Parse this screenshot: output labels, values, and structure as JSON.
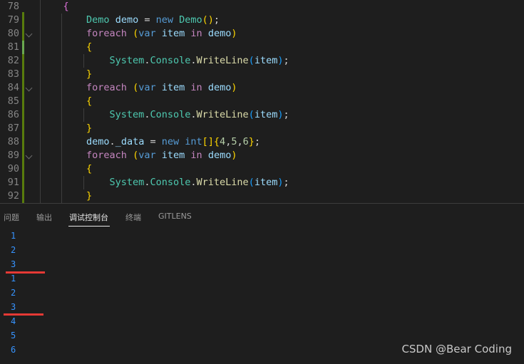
{
  "editor": {
    "lines": [
      {
        "num": "78",
        "fold": false,
        "tokens": [
          {
            "t": "    "
          },
          {
            "t": "{",
            "c": "b1"
          }
        ]
      },
      {
        "num": "79",
        "fold": false,
        "tokens": [
          {
            "t": "        "
          },
          {
            "t": "Demo",
            "c": "type"
          },
          {
            "t": " "
          },
          {
            "t": "demo",
            "c": "var"
          },
          {
            "t": " = ",
            "c": "p"
          },
          {
            "t": "new",
            "c": "kw"
          },
          {
            "t": " "
          },
          {
            "t": "Demo",
            "c": "type"
          },
          {
            "t": "()",
            "c": "b2"
          },
          {
            "t": ";",
            "c": "p"
          }
        ]
      },
      {
        "num": "80",
        "fold": true,
        "tokens": [
          {
            "t": "        "
          },
          {
            "t": "foreach",
            "c": "ctrl"
          },
          {
            "t": " "
          },
          {
            "t": "(",
            "c": "b2"
          },
          {
            "t": "var",
            "c": "kw"
          },
          {
            "t": " "
          },
          {
            "t": "item",
            "c": "var"
          },
          {
            "t": " "
          },
          {
            "t": "in",
            "c": "ctrl"
          },
          {
            "t": " "
          },
          {
            "t": "demo",
            "c": "var"
          },
          {
            "t": ")",
            "c": "b2"
          }
        ]
      },
      {
        "num": "81",
        "fold": false,
        "tokens": [
          {
            "t": "        "
          },
          {
            "t": "{",
            "c": "b2"
          }
        ]
      },
      {
        "num": "82",
        "fold": false,
        "tokens": [
          {
            "t": "            "
          },
          {
            "t": "System",
            "c": "type"
          },
          {
            "t": ".",
            "c": "p"
          },
          {
            "t": "Console",
            "c": "type"
          },
          {
            "t": ".",
            "c": "p"
          },
          {
            "t": "WriteLine",
            "c": "fn"
          },
          {
            "t": "(",
            "c": "b3"
          },
          {
            "t": "item",
            "c": "var"
          },
          {
            "t": ")",
            "c": "b3"
          },
          {
            "t": ";",
            "c": "p"
          }
        ]
      },
      {
        "num": "83",
        "fold": false,
        "tokens": [
          {
            "t": "        "
          },
          {
            "t": "}",
            "c": "b2"
          }
        ]
      },
      {
        "num": "84",
        "fold": true,
        "tokens": [
          {
            "t": "        "
          },
          {
            "t": "foreach",
            "c": "ctrl"
          },
          {
            "t": " "
          },
          {
            "t": "(",
            "c": "b2"
          },
          {
            "t": "var",
            "c": "kw"
          },
          {
            "t": " "
          },
          {
            "t": "item",
            "c": "var"
          },
          {
            "t": " "
          },
          {
            "t": "in",
            "c": "ctrl"
          },
          {
            "t": " "
          },
          {
            "t": "demo",
            "c": "var"
          },
          {
            "t": ")",
            "c": "b2"
          }
        ]
      },
      {
        "num": "85",
        "fold": false,
        "tokens": [
          {
            "t": "        "
          },
          {
            "t": "{",
            "c": "b2"
          }
        ]
      },
      {
        "num": "86",
        "fold": false,
        "tokens": [
          {
            "t": "            "
          },
          {
            "t": "System",
            "c": "type"
          },
          {
            "t": ".",
            "c": "p"
          },
          {
            "t": "Console",
            "c": "type"
          },
          {
            "t": ".",
            "c": "p"
          },
          {
            "t": "WriteLine",
            "c": "fn"
          },
          {
            "t": "(",
            "c": "b3"
          },
          {
            "t": "item",
            "c": "var"
          },
          {
            "t": ")",
            "c": "b3"
          },
          {
            "t": ";",
            "c": "p"
          }
        ]
      },
      {
        "num": "87",
        "fold": false,
        "tokens": [
          {
            "t": "        "
          },
          {
            "t": "}",
            "c": "b2"
          }
        ]
      },
      {
        "num": "88",
        "fold": false,
        "tokens": [
          {
            "t": "        "
          },
          {
            "t": "demo",
            "c": "var"
          },
          {
            "t": ".",
            "c": "p"
          },
          {
            "t": "_data",
            "c": "var"
          },
          {
            "t": " = ",
            "c": "p"
          },
          {
            "t": "new",
            "c": "kw"
          },
          {
            "t": " "
          },
          {
            "t": "int",
            "c": "kw"
          },
          {
            "t": "[]",
            "c": "b2"
          },
          {
            "t": "{",
            "c": "b2"
          },
          {
            "t": "4",
            "c": "num"
          },
          {
            "t": ",",
            "c": "p"
          },
          {
            "t": "5",
            "c": "num"
          },
          {
            "t": ",",
            "c": "p"
          },
          {
            "t": "6",
            "c": "num"
          },
          {
            "t": "}",
            "c": "b2"
          },
          {
            "t": ";",
            "c": "p"
          }
        ]
      },
      {
        "num": "89",
        "fold": true,
        "tokens": [
          {
            "t": "        "
          },
          {
            "t": "foreach",
            "c": "ctrl"
          },
          {
            "t": " "
          },
          {
            "t": "(",
            "c": "b2"
          },
          {
            "t": "var",
            "c": "kw"
          },
          {
            "t": " "
          },
          {
            "t": "item",
            "c": "var"
          },
          {
            "t": " "
          },
          {
            "t": "in",
            "c": "ctrl"
          },
          {
            "t": " "
          },
          {
            "t": "demo",
            "c": "var"
          },
          {
            "t": ")",
            "c": "b2"
          }
        ]
      },
      {
        "num": "90",
        "fold": false,
        "tokens": [
          {
            "t": "        "
          },
          {
            "t": "{",
            "c": "b2"
          }
        ]
      },
      {
        "num": "91",
        "fold": false,
        "tokens": [
          {
            "t": "            "
          },
          {
            "t": "System",
            "c": "type"
          },
          {
            "t": ".",
            "c": "p"
          },
          {
            "t": "Console",
            "c": "type"
          },
          {
            "t": ".",
            "c": "p"
          },
          {
            "t": "WriteLine",
            "c": "fn"
          },
          {
            "t": "(",
            "c": "b3"
          },
          {
            "t": "item",
            "c": "var"
          },
          {
            "t": ")",
            "c": "b3"
          },
          {
            "t": ";",
            "c": "p"
          }
        ]
      },
      {
        "num": "92",
        "fold": false,
        "tokens": [
          {
            "t": "        "
          },
          {
            "t": "}",
            "c": "b2"
          }
        ]
      }
    ]
  },
  "panel": {
    "tabs": [
      {
        "label": "问题",
        "active": false
      },
      {
        "label": "输出",
        "active": false
      },
      {
        "label": "调试控制台",
        "active": true
      },
      {
        "label": "终端",
        "active": false
      },
      {
        "label": "GITLENS",
        "active": false
      }
    ],
    "console_output": [
      "1",
      "2",
      "3",
      "1",
      "2",
      "3",
      "4",
      "5",
      "6"
    ]
  },
  "watermark": "CSDN @Bear Coding",
  "colors": {
    "background": "#1e1e1e",
    "keyword": "#569cd6",
    "control": "#c586c0",
    "type": "#4ec9b0",
    "variable": "#9cdcfe",
    "function": "#dcdcaa",
    "number": "#b5cea8",
    "console_text": "#3794ff",
    "annotation_marker": "#e53935",
    "git_added": "#587c0c"
  }
}
